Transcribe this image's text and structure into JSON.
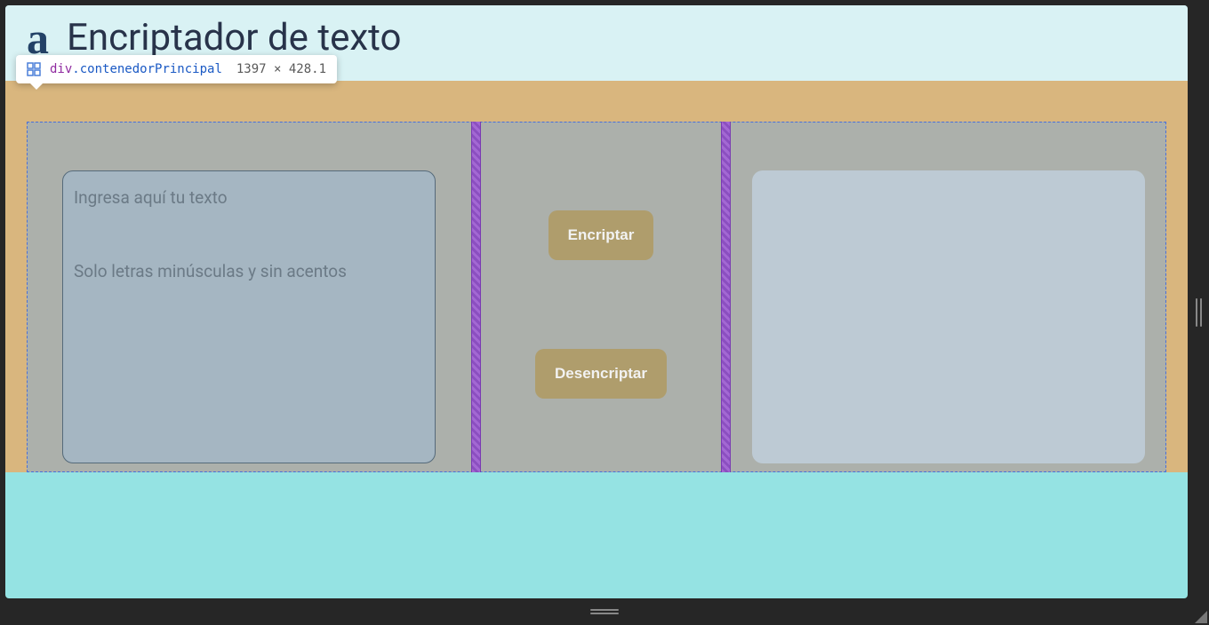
{
  "header": {
    "logo": "a",
    "title": "Encriptador de texto"
  },
  "devtools": {
    "tag": "div",
    "class": ".contenedorPrincipal",
    "dimensions": "1397 × 428.1"
  },
  "input": {
    "placeholder": "Ingresa aquí tu texto",
    "hint": "Solo letras minúsculas y sin acentos"
  },
  "buttons": {
    "encrypt": "Encriptar",
    "decrypt": "Desencriptar"
  }
}
